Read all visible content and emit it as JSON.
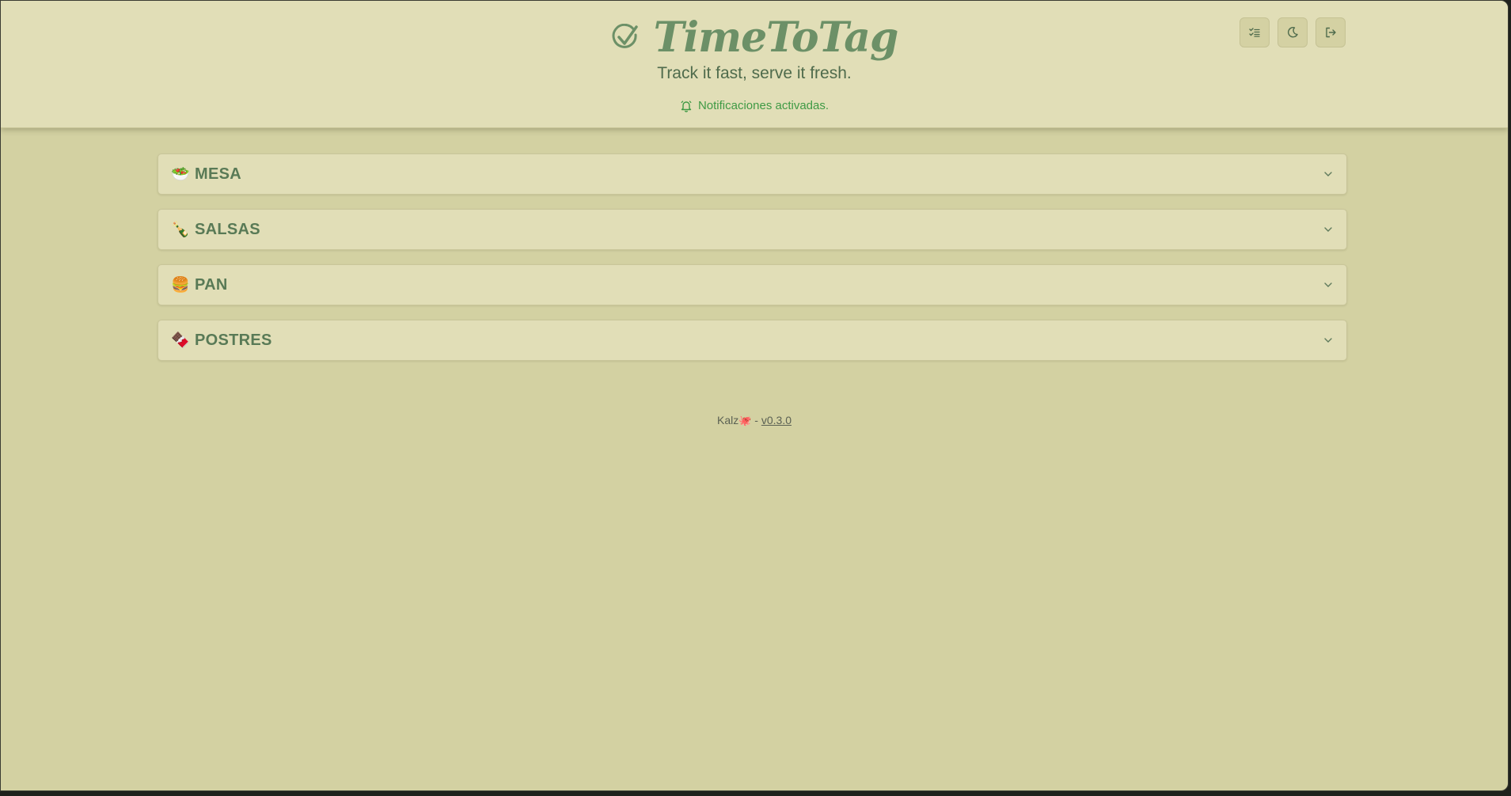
{
  "header": {
    "title": "TimeToTag",
    "tagline": "Track it fast, serve it fresh.",
    "notification": "Notificaciones activadas."
  },
  "header_buttons": [
    {
      "icon": "list-check-icon"
    },
    {
      "icon": "moon-icon"
    },
    {
      "icon": "logout-icon"
    }
  ],
  "sections": [
    {
      "emoji": "🥗",
      "label": "MESA"
    },
    {
      "emoji": "🍾",
      "label": "SALSAS"
    },
    {
      "emoji": "🍔",
      "label": "PAN"
    },
    {
      "emoji": "🍫",
      "label": "POSTRES"
    }
  ],
  "footer": {
    "author": "Kalz",
    "author_logo": "🐙",
    "separator": "-",
    "version": "v0.3.0"
  },
  "colors": {
    "page_bg": "#d3d1a2",
    "header_bg": "#e1deb7",
    "brand_green": "#6c9067",
    "notification_green": "#3f9a45"
  }
}
